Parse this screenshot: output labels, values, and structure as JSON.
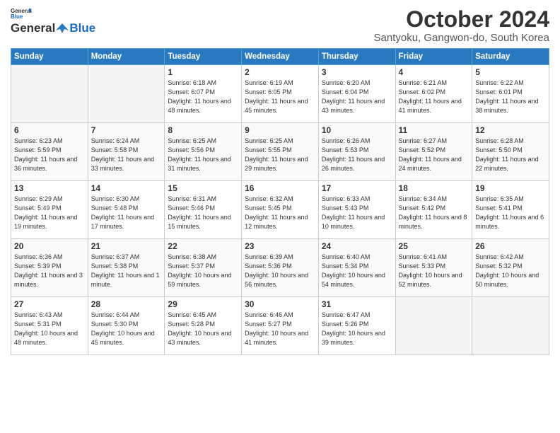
{
  "header": {
    "logo_general": "General",
    "logo_blue": "Blue",
    "month_title": "October 2024",
    "location": "Santyoku, Gangwon-do, South Korea"
  },
  "days_of_week": [
    "Sunday",
    "Monday",
    "Tuesday",
    "Wednesday",
    "Thursday",
    "Friday",
    "Saturday"
  ],
  "weeks": [
    [
      {
        "day": "",
        "info": "",
        "empty": true
      },
      {
        "day": "",
        "info": "",
        "empty": true
      },
      {
        "day": "1",
        "info": "Sunrise: 6:18 AM\nSunset: 6:07 PM\nDaylight: 11 hours and 48 minutes."
      },
      {
        "day": "2",
        "info": "Sunrise: 6:19 AM\nSunset: 6:05 PM\nDaylight: 11 hours and 45 minutes."
      },
      {
        "day": "3",
        "info": "Sunrise: 6:20 AM\nSunset: 6:04 PM\nDaylight: 11 hours and 43 minutes."
      },
      {
        "day": "4",
        "info": "Sunrise: 6:21 AM\nSunset: 6:02 PM\nDaylight: 11 hours and 41 minutes."
      },
      {
        "day": "5",
        "info": "Sunrise: 6:22 AM\nSunset: 6:01 PM\nDaylight: 11 hours and 38 minutes."
      }
    ],
    [
      {
        "day": "6",
        "info": "Sunrise: 6:23 AM\nSunset: 5:59 PM\nDaylight: 11 hours and 36 minutes."
      },
      {
        "day": "7",
        "info": "Sunrise: 6:24 AM\nSunset: 5:58 PM\nDaylight: 11 hours and 33 minutes."
      },
      {
        "day": "8",
        "info": "Sunrise: 6:25 AM\nSunset: 5:56 PM\nDaylight: 11 hours and 31 minutes."
      },
      {
        "day": "9",
        "info": "Sunrise: 6:25 AM\nSunset: 5:55 PM\nDaylight: 11 hours and 29 minutes."
      },
      {
        "day": "10",
        "info": "Sunrise: 6:26 AM\nSunset: 5:53 PM\nDaylight: 11 hours and 26 minutes."
      },
      {
        "day": "11",
        "info": "Sunrise: 6:27 AM\nSunset: 5:52 PM\nDaylight: 11 hours and 24 minutes."
      },
      {
        "day": "12",
        "info": "Sunrise: 6:28 AM\nSunset: 5:50 PM\nDaylight: 11 hours and 22 minutes."
      }
    ],
    [
      {
        "day": "13",
        "info": "Sunrise: 6:29 AM\nSunset: 5:49 PM\nDaylight: 11 hours and 19 minutes."
      },
      {
        "day": "14",
        "info": "Sunrise: 6:30 AM\nSunset: 5:48 PM\nDaylight: 11 hours and 17 minutes."
      },
      {
        "day": "15",
        "info": "Sunrise: 6:31 AM\nSunset: 5:46 PM\nDaylight: 11 hours and 15 minutes."
      },
      {
        "day": "16",
        "info": "Sunrise: 6:32 AM\nSunset: 5:45 PM\nDaylight: 11 hours and 12 minutes."
      },
      {
        "day": "17",
        "info": "Sunrise: 6:33 AM\nSunset: 5:43 PM\nDaylight: 11 hours and 10 minutes."
      },
      {
        "day": "18",
        "info": "Sunrise: 6:34 AM\nSunset: 5:42 PM\nDaylight: 11 hours and 8 minutes."
      },
      {
        "day": "19",
        "info": "Sunrise: 6:35 AM\nSunset: 5:41 PM\nDaylight: 11 hours and 6 minutes."
      }
    ],
    [
      {
        "day": "20",
        "info": "Sunrise: 6:36 AM\nSunset: 5:39 PM\nDaylight: 11 hours and 3 minutes."
      },
      {
        "day": "21",
        "info": "Sunrise: 6:37 AM\nSunset: 5:38 PM\nDaylight: 11 hours and 1 minute."
      },
      {
        "day": "22",
        "info": "Sunrise: 6:38 AM\nSunset: 5:37 PM\nDaylight: 10 hours and 59 minutes."
      },
      {
        "day": "23",
        "info": "Sunrise: 6:39 AM\nSunset: 5:36 PM\nDaylight: 10 hours and 56 minutes."
      },
      {
        "day": "24",
        "info": "Sunrise: 6:40 AM\nSunset: 5:34 PM\nDaylight: 10 hours and 54 minutes."
      },
      {
        "day": "25",
        "info": "Sunrise: 6:41 AM\nSunset: 5:33 PM\nDaylight: 10 hours and 52 minutes."
      },
      {
        "day": "26",
        "info": "Sunrise: 6:42 AM\nSunset: 5:32 PM\nDaylight: 10 hours and 50 minutes."
      }
    ],
    [
      {
        "day": "27",
        "info": "Sunrise: 6:43 AM\nSunset: 5:31 PM\nDaylight: 10 hours and 48 minutes."
      },
      {
        "day": "28",
        "info": "Sunrise: 6:44 AM\nSunset: 5:30 PM\nDaylight: 10 hours and 45 minutes."
      },
      {
        "day": "29",
        "info": "Sunrise: 6:45 AM\nSunset: 5:28 PM\nDaylight: 10 hours and 43 minutes."
      },
      {
        "day": "30",
        "info": "Sunrise: 6:46 AM\nSunset: 5:27 PM\nDaylight: 10 hours and 41 minutes."
      },
      {
        "day": "31",
        "info": "Sunrise: 6:47 AM\nSunset: 5:26 PM\nDaylight: 10 hours and 39 minutes."
      },
      {
        "day": "",
        "info": "",
        "empty": true
      },
      {
        "day": "",
        "info": "",
        "empty": true
      }
    ]
  ]
}
